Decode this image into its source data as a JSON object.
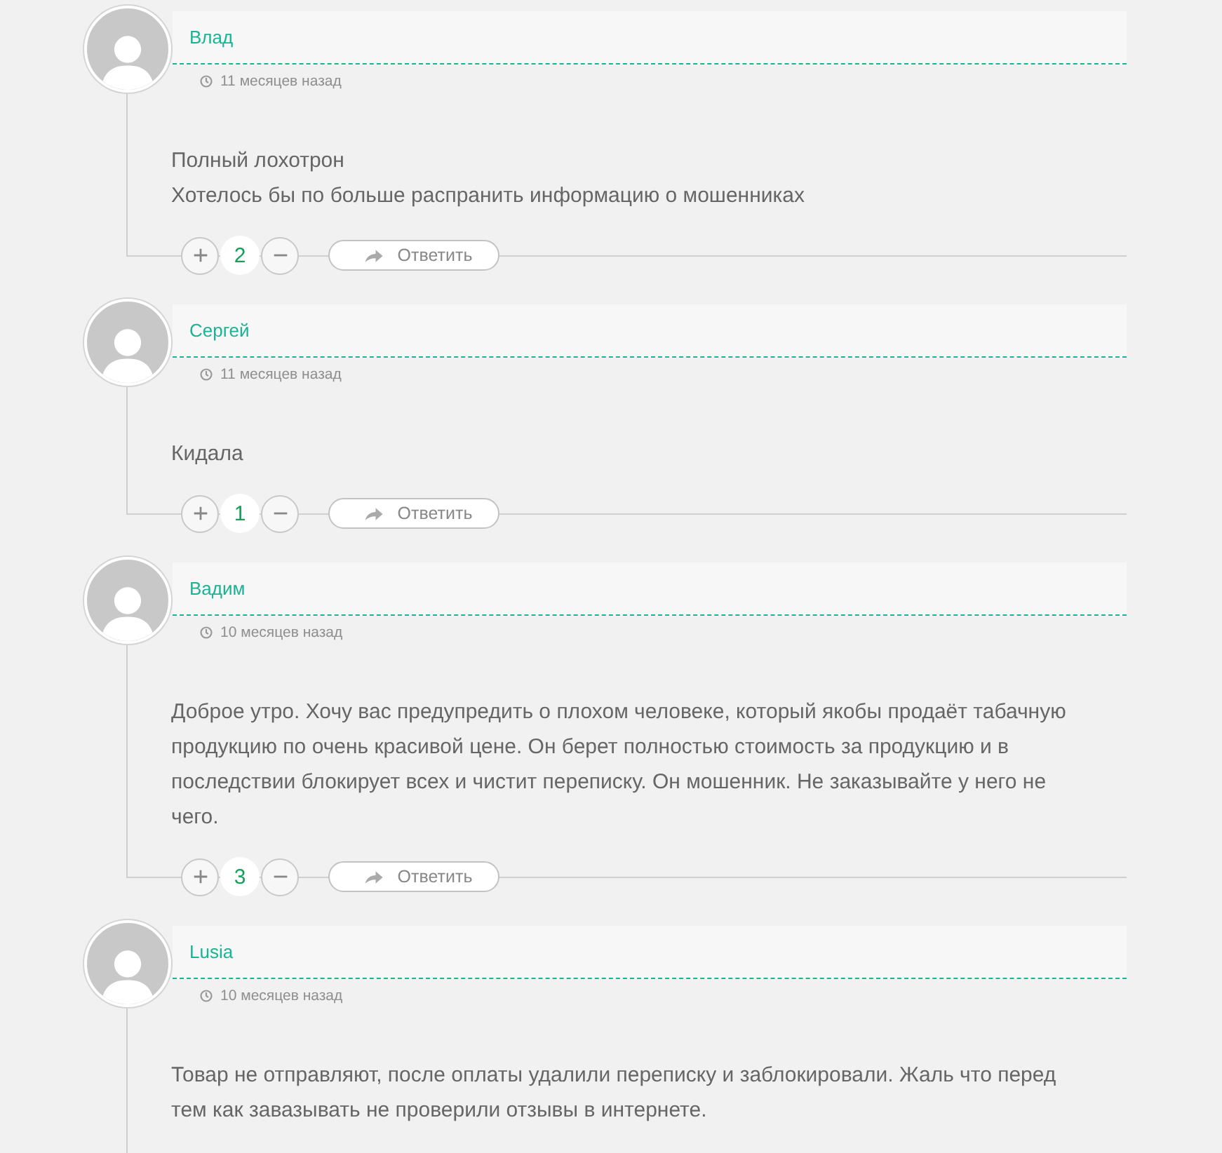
{
  "comments": [
    {
      "author": "Влад",
      "time": "11 месяцев назад",
      "paragraphs": [
        "Полный лохотрон",
        "Хотелось бы по больше распранить информацию о мошенниках"
      ],
      "votes": "2",
      "reply": "Ответить"
    },
    {
      "author": "Сергей",
      "time": "11 месяцев назад",
      "paragraphs": [
        "Кидала"
      ],
      "votes": "1",
      "reply": "Ответить"
    },
    {
      "author": "Вадим",
      "time": "10 месяцев назад",
      "paragraphs": [
        "Доброе утро. Хочу вас предупредить о плохом человеке, который якобы продаёт табачную продукцию по очень красивой цене. Он берет полностью стоимость за продукцию и в последствии блокирует всех и чистит переписку. Он мошенник. Не заказывайте у него не чего."
      ],
      "votes": "3",
      "reply": "Ответить"
    },
    {
      "author": "Lusia",
      "time": "10 месяцев назад",
      "paragraphs": [
        "Товар не отправляют, после оплаты удалили переписку и заблокировали. Жаль что перед тем как завазывать не проверили отзывы в интернете."
      ]
    }
  ]
}
